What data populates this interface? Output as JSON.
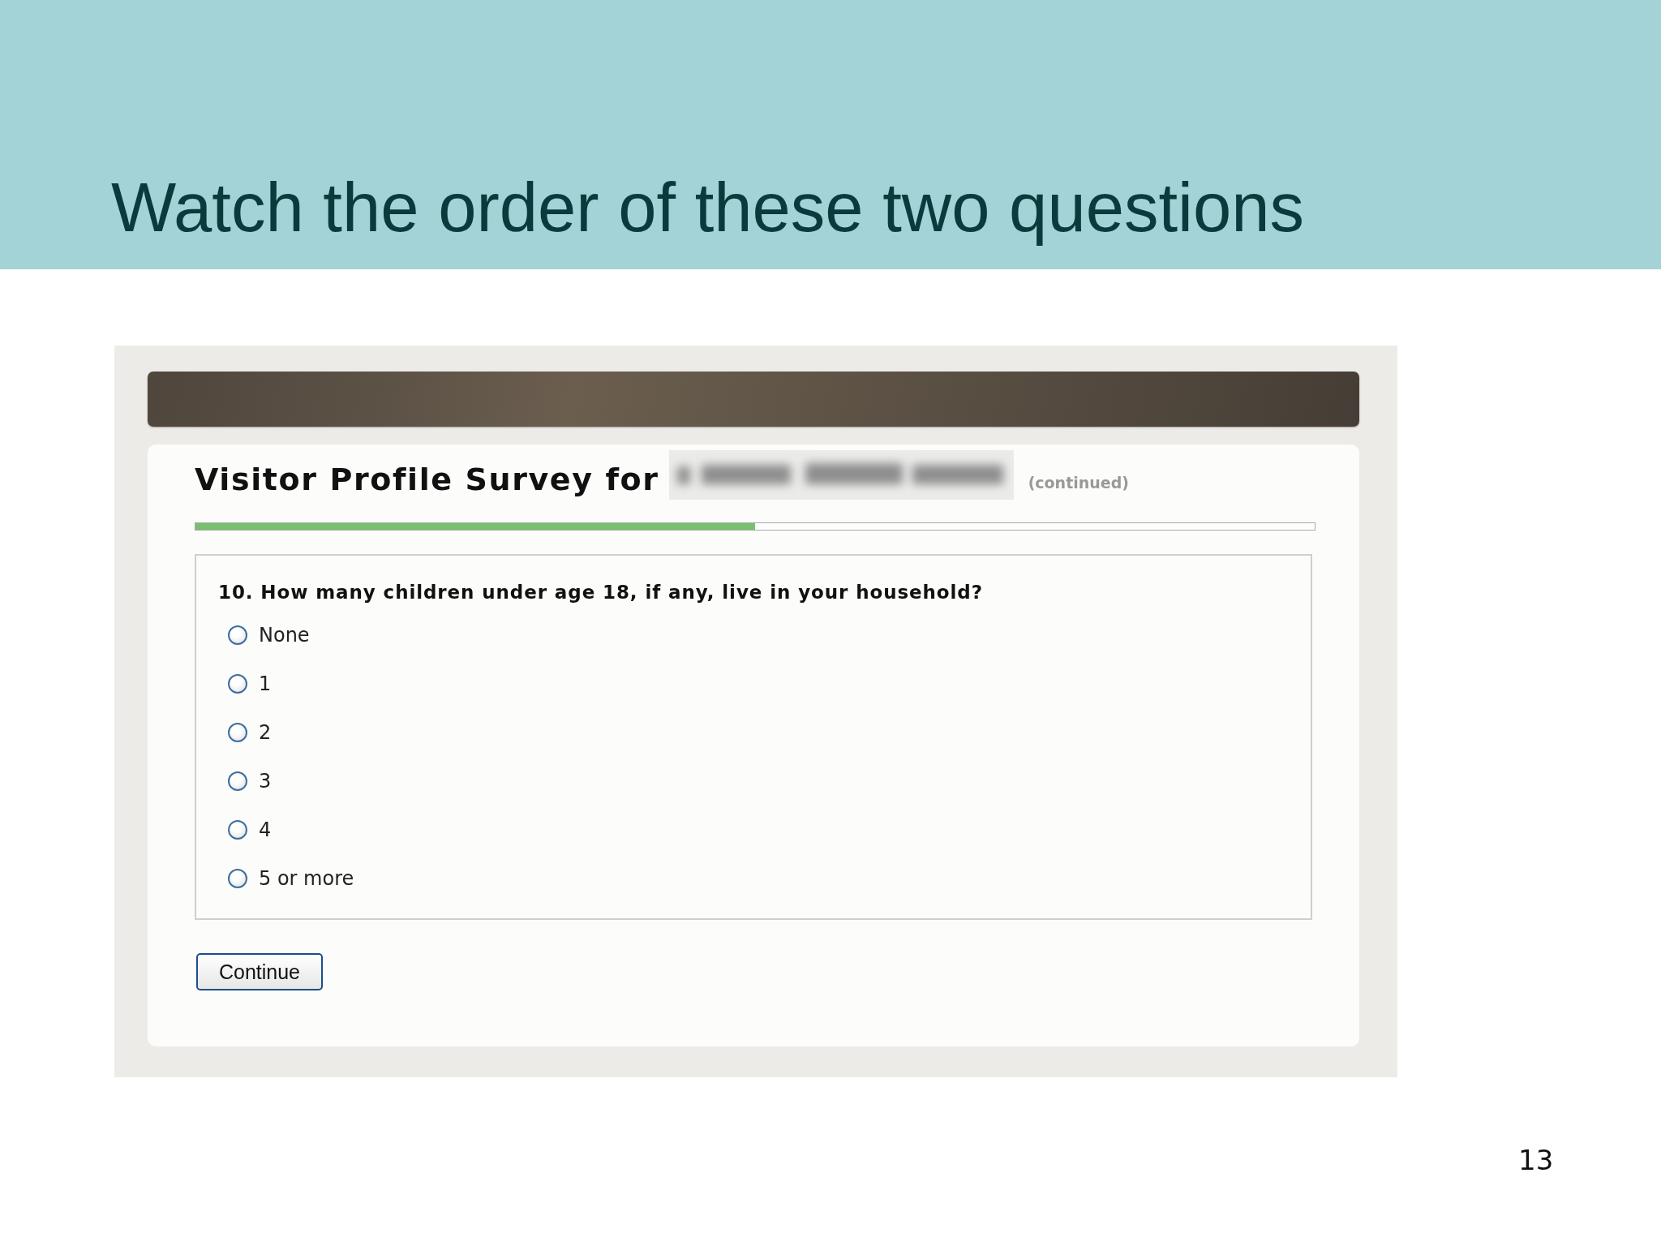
{
  "slide": {
    "title": "Watch the order of these two questions",
    "page_number": "13"
  },
  "survey": {
    "title": "Visitor Profile Survey for",
    "continued": "(continued)",
    "progress": {
      "level": 0.5
    },
    "question": {
      "text": "10. How many children under age 18, if any, live in your household?",
      "options": [
        {
          "label": "None",
          "selected": false
        },
        {
          "label": "1",
          "selected": false
        },
        {
          "label": "2",
          "selected": false
        },
        {
          "label": "3",
          "selected": false
        },
        {
          "label": "4",
          "selected": false
        },
        {
          "label": "5 or more",
          "selected": false
        }
      ]
    },
    "buttons": [
      "Continue"
    ]
  }
}
